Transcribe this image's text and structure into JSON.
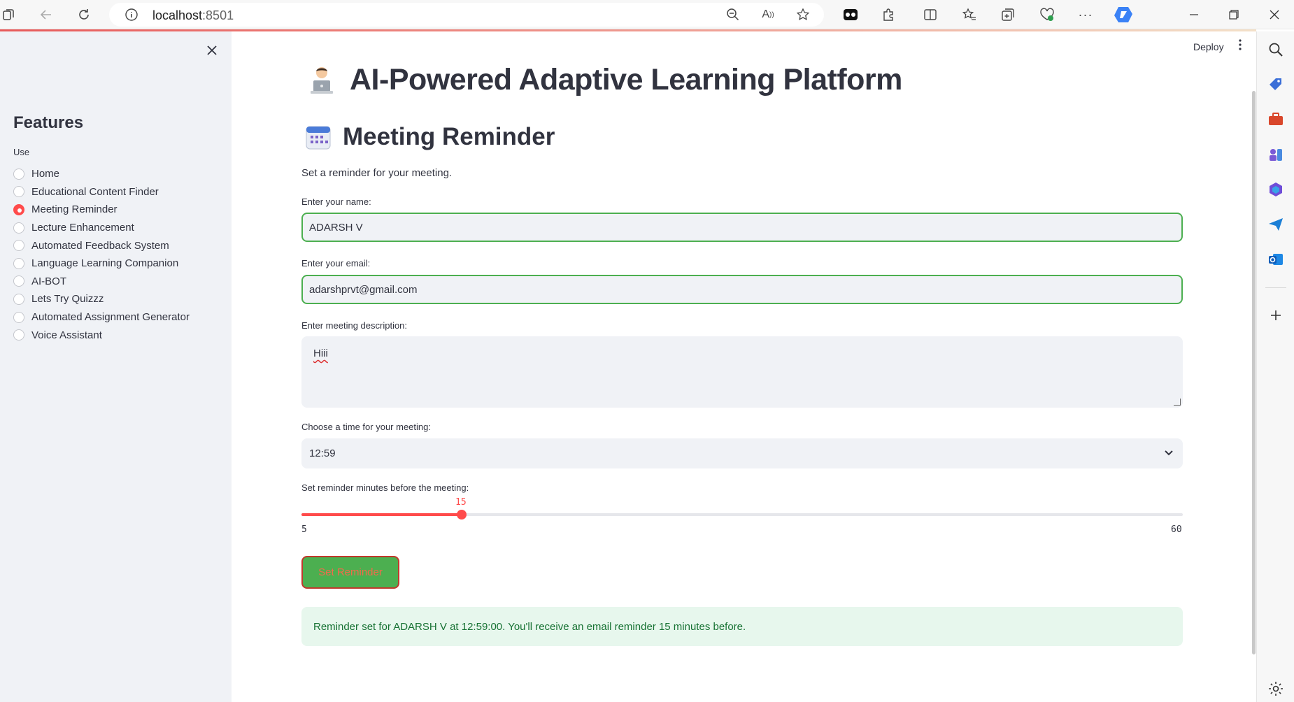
{
  "browser": {
    "url_host": "localhost",
    "url_port": ":8501"
  },
  "sidebar": {
    "title": "Features",
    "radio_label": "Use",
    "items": [
      {
        "label": "Home",
        "selected": false
      },
      {
        "label": "Educational Content Finder",
        "selected": false
      },
      {
        "label": "Meeting Reminder",
        "selected": true
      },
      {
        "label": "Lecture Enhancement",
        "selected": false
      },
      {
        "label": "Automated Feedback System",
        "selected": false
      },
      {
        "label": "Language Learning Companion",
        "selected": false
      },
      {
        "label": "AI-BOT",
        "selected": false
      },
      {
        "label": "Lets Try Quizzz",
        "selected": false
      },
      {
        "label": "Automated Assignment Generator",
        "selected": false
      },
      {
        "label": "Voice Assistant",
        "selected": false
      }
    ]
  },
  "header": {
    "deploy_label": "Deploy"
  },
  "main": {
    "title": "AI-Powered Adaptive Learning Platform",
    "section_title": "Meeting Reminder",
    "description": "Set a reminder for your meeting.",
    "name_label": "Enter your name:",
    "name_value": "ADARSH V",
    "email_label": "Enter your email:",
    "email_value": "adarshprvt@gmail.com",
    "meeting_desc_label": "Enter meeting description:",
    "meeting_desc_value": "Hiii",
    "time_label": "Choose a time for your meeting:",
    "time_value": "12:59",
    "slider_label": "Set reminder minutes before the meeting:",
    "slider_value": "15",
    "slider_min": "5",
    "slider_max": "60",
    "button_label": "Set Reminder",
    "success_message": "Reminder set for ADARSH V at 12:59:00. You'll receive an email reminder 15 minutes before."
  },
  "colors": {
    "accent": "#ff4b4b",
    "success_border": "#4caf50",
    "sidebar_bg": "#f0f2f6"
  }
}
